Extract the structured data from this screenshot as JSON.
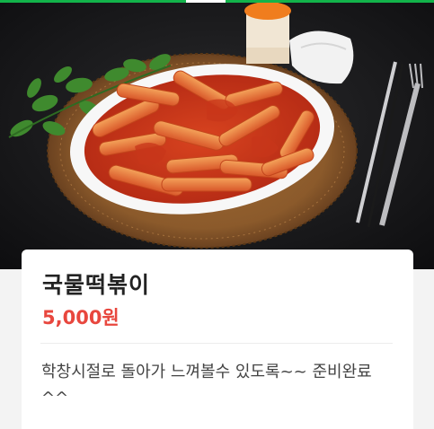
{
  "product": {
    "name": "국물떡볶이",
    "price": "5,000원",
    "description": "학창시절로 돌아가 느껴볼수 있도록~~ 준비완료^^",
    "image_subject": "tteokbokki-dish-photo"
  },
  "colors": {
    "accent_bar": "#12b34a",
    "price": "#e8473e",
    "title": "#222222",
    "description": "#444444"
  }
}
